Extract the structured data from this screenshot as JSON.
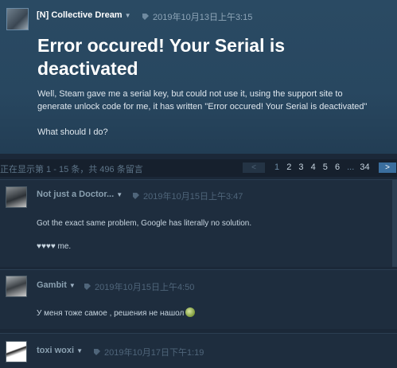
{
  "op": {
    "author": "[N] Collective Dream",
    "date": "2019年10月13日上午3:15",
    "title": "Error occured! Your Serial is deactivated",
    "body_line1": "Well, Steam gave me a serial key, but could not use it, using the support site to",
    "body_line2": "generate unlock code for me, it has written \"Error occured! Your Serial is deactivated\"",
    "question": "What should I do?"
  },
  "pagination": {
    "count_text": "正在显示第 1 - 15 条，共 496 条留言",
    "prev": "<",
    "next": ">",
    "pages": [
      "1",
      "2",
      "3",
      "4",
      "5",
      "6",
      "...",
      "34"
    ],
    "current": "1"
  },
  "comments": [
    {
      "author": "Not just a Doctor...",
      "date": "2019年10月15日上午3:47",
      "line1": "Got the exact same problem, Google has literally no solution.",
      "line2": "♥♥♥♥ me."
    },
    {
      "author": "Gambit",
      "date": "2019年10月15日上午4:50",
      "line1": "У меня тоже самое , решения не нашол"
    },
    {
      "author": "toxi woxi",
      "date": "2019年10月17日下午1:19"
    }
  ],
  "colors": {
    "background": "#1b2838",
    "op_panel": "#284760",
    "accent_next": "#3a6e9e"
  }
}
